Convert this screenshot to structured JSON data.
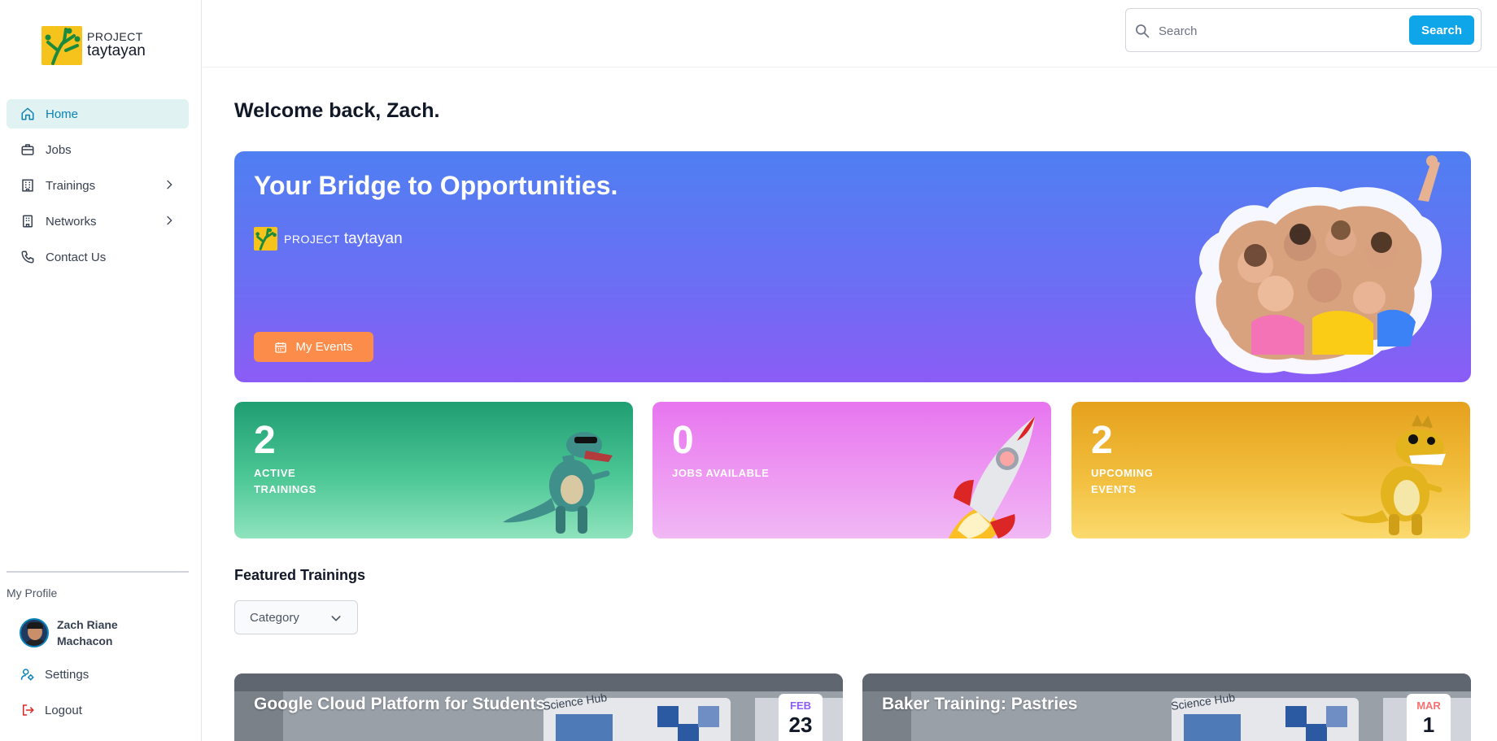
{
  "brand": {
    "line1": "PROJECT",
    "line2": "taytayan"
  },
  "sidebar": {
    "items": [
      {
        "label": "Home",
        "icon": "home-icon",
        "active": true
      },
      {
        "label": "Jobs",
        "icon": "briefcase-icon"
      },
      {
        "label": "Trainings",
        "icon": "building-icon",
        "expandable": true
      },
      {
        "label": "Networks",
        "icon": "network-building-icon",
        "expandable": true
      },
      {
        "label": "Contact Us",
        "icon": "phone-icon"
      }
    ],
    "profile_title": "My Profile",
    "user_name": "Zach Riane Machacon",
    "settings_label": "Settings",
    "logout_label": "Logout"
  },
  "search": {
    "placeholder": "Search",
    "button_label": "Search"
  },
  "main": {
    "welcome": "Welcome back, Zach.",
    "hero": {
      "title": "Your Bridge to Opportunities.",
      "logo_line1": "PROJECT",
      "logo_line2": "taytayan",
      "button_label": "My Events"
    },
    "stats": [
      {
        "value": "2",
        "label": "ACTIVE TRAININGS",
        "color": "#1f9e73"
      },
      {
        "value": "0",
        "label": "JOBS AVAILABLE",
        "color": "#e775ef"
      },
      {
        "value": "2",
        "label": "UPCOMING EVENTS",
        "color": "#e5a11d"
      }
    ],
    "featured_title": "Featured Trainings",
    "category_label": "Category",
    "trainings": [
      {
        "title": "Google Cloud Platform for Students",
        "month": "FEB",
        "day": "23",
        "month_color": "#8b5cf6"
      },
      {
        "title": "Baker Training: Pastries",
        "month": "MAR",
        "day": "1",
        "month_color": "#f87171"
      }
    ]
  },
  "colors": {
    "accent": "#0ea5e9",
    "active_nav_bg": "#e0f2f1",
    "active_nav_text": "#0b83b8",
    "event_button": "#fb8c4a",
    "logout_icon": "#dc2626",
    "settings_icon": "#0b83b8"
  }
}
